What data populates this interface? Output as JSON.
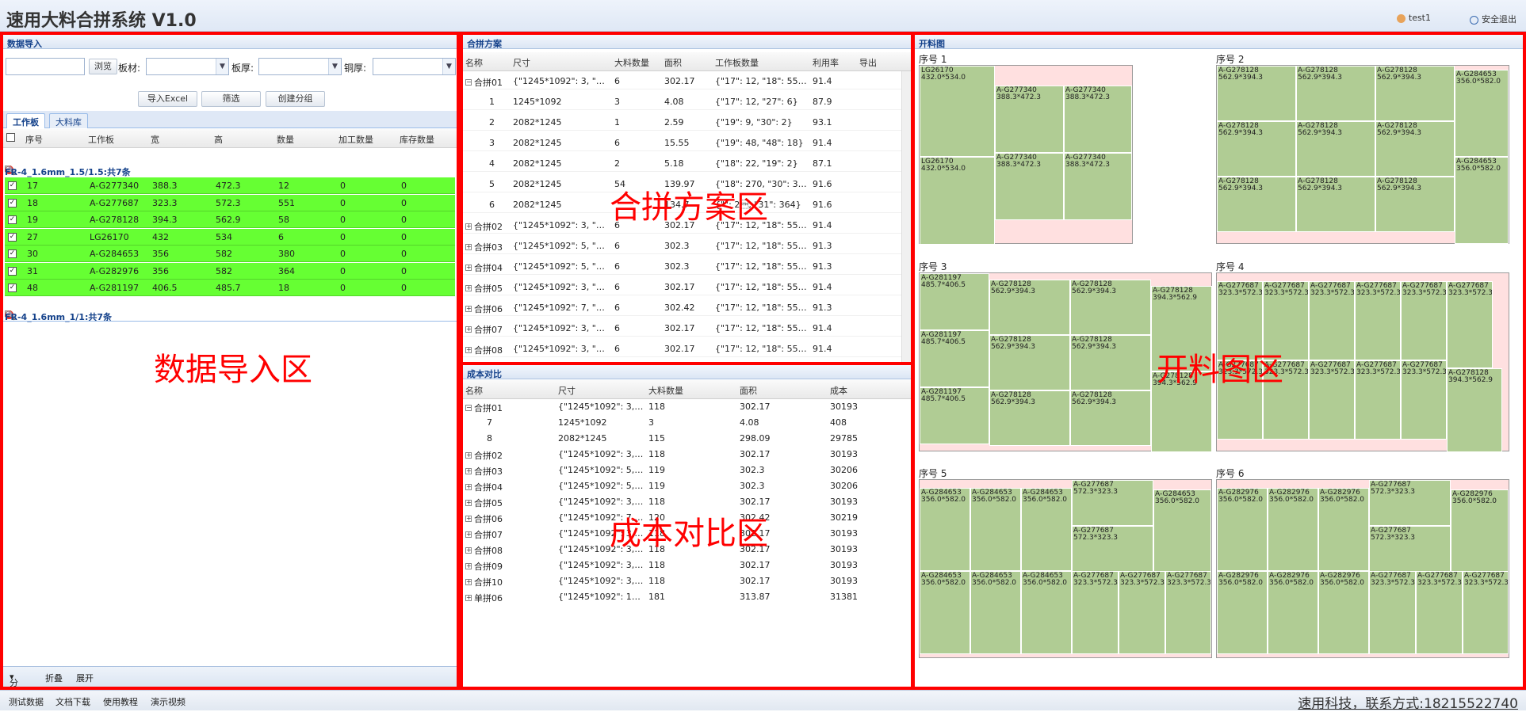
{
  "app": {
    "title": "速用大料合拼系统 V1.0",
    "user": "test1",
    "logout": "安全退出"
  },
  "zones": {
    "import": "数据导入区",
    "plan": "合拼方案区",
    "cost": "成本对比区",
    "cut": "开料图区"
  },
  "import": {
    "header": "数据导入",
    "browse": "浏览",
    "board_label": "板材:",
    "thickness_label": "板厚:",
    "copper_label": "铜厚:",
    "btn_excel": "导入Excel",
    "btn_filter": "筛选",
    "btn_group": "创建分组",
    "tabs": [
      "工作板",
      "大料库"
    ],
    "columns": [
      "序号",
      "工作板",
      "宽",
      "高",
      "数量",
      "加工数量",
      "库存数量"
    ],
    "group1": "FR-4_1.6mm_1.5/1.5:共7条",
    "group2": "FR-4_1.6mm_1/1:共7条",
    "rows": [
      [
        "17",
        "A-G277340",
        "388.3",
        "472.3",
        "12",
        "0",
        "0"
      ],
      [
        "18",
        "A-G277687",
        "323.3",
        "572.3",
        "551",
        "0",
        "0"
      ],
      [
        "19",
        "A-G278128",
        "394.3",
        "562.9",
        "58",
        "0",
        "0"
      ],
      [
        "27",
        "LG26170",
        "432",
        "534",
        "6",
        "0",
        "0"
      ],
      [
        "30",
        "A-G284653",
        "356",
        "582",
        "380",
        "0",
        "0"
      ],
      [
        "31",
        "A-G282976",
        "356",
        "582",
        "364",
        "0",
        "0"
      ],
      [
        "48",
        "A-G281197",
        "406.5",
        "485.7",
        "18",
        "0",
        "0"
      ]
    ],
    "toolbar": {
      "group": "分组",
      "collapse": "折叠",
      "expand": "展开"
    }
  },
  "plan": {
    "header": "合拼方案",
    "columns": [
      "名称",
      "尺寸",
      "大料数量",
      "面积",
      "工作板数量",
      "利用率",
      "导出"
    ],
    "rows": [
      [
        "合拼01",
        "{\"1245*1092\": 3, \"20...",
        "6",
        "302.17",
        "{\"17\": 12, \"18\": 552, ...",
        "91.4",
        "g"
      ],
      [
        "1",
        "1245*1092",
        "3",
        "4.08",
        "{\"17\": 12, \"27\": 6}",
        "87.9",
        "c"
      ],
      [
        "2",
        "2082*1245",
        "1",
        "2.59",
        "{\"19\": 9, \"30\": 2}",
        "93.1",
        "c"
      ],
      [
        "3",
        "2082*1245",
        "6",
        "15.55",
        "{\"19\": 48, \"48\": 18}",
        "91.4",
        "c"
      ],
      [
        "4",
        "2082*1245",
        "2",
        "5.18",
        "{\"18\": 22, \"19\": 2}",
        "87.1",
        "c"
      ],
      [
        "5",
        "2082*1245",
        "54",
        "139.97",
        "{\"18\": 270, \"30\": 378}",
        "91.6",
        "c"
      ],
      [
        "6",
        "2082*1245",
        "",
        "134.7",
        "{\"\": 2\u0002, \"31\": 364}",
        "91.6",
        "c"
      ],
      [
        "合拼02",
        "{\"1245*1092\": 3, \"20...",
        "6",
        "302.17",
        "{\"17\": 12, \"18\": 554, ...",
        "91.4",
        "g"
      ],
      [
        "合拼03",
        "{\"1245*1092\": 5, \"20...",
        "6",
        "302.3",
        "{\"17\": 12, \"18\": 552, ...",
        "91.3",
        "g"
      ],
      [
        "合拼04",
        "{\"1245*1092\": 5, \"20...",
        "6",
        "302.3",
        "{\"17\": 12, \"18\": 552, ...",
        "91.3",
        "g"
      ],
      [
        "合拼05",
        "{\"1245*1092\": 3, \"20...",
        "6",
        "302.17",
        "{\"17\": 12, \"18\": 551, ...",
        "91.4",
        "g"
      ],
      [
        "合拼06",
        "{\"1245*1092\": 7, \"20...",
        "6",
        "302.42",
        "{\"17\": 12, \"18\": 551, ...",
        "91.3",
        "g"
      ],
      [
        "合拼07",
        "{\"1245*1092\": 3, \"20...",
        "6",
        "302.17",
        "{\"17\": 12, \"18\": 551, ...",
        "91.4",
        "g"
      ],
      [
        "合拼08",
        "{\"1245*1092\": 3, \"20...",
        "6",
        "302.17",
        "{\"17\": 12, \"18\": 552, ...",
        "91.4",
        "g"
      ]
    ]
  },
  "cost": {
    "header": "成本对比",
    "columns": [
      "名称",
      "尺寸",
      "大料数量",
      "面积",
      "成本"
    ],
    "rows": [
      [
        "合拼01",
        "{\"1245*1092\": 3, \"...",
        "118",
        "302.17",
        "30193",
        "g"
      ],
      [
        "7",
        "1245*1092",
        "3",
        "4.08",
        "408",
        "c"
      ],
      [
        "8",
        "2082*1245",
        "115",
        "298.09",
        "29785",
        "c"
      ],
      [
        "合拼02",
        "{\"1245*1092\": 3, \"...",
        "118",
        "302.17",
        "30193",
        "g"
      ],
      [
        "合拼03",
        "{\"1245*1092\": 5, \"...",
        "119",
        "302.3",
        "30206",
        "g"
      ],
      [
        "合拼04",
        "{\"1245*1092\": 5, \"...",
        "119",
        "302.3",
        "30206",
        "g"
      ],
      [
        "合拼05",
        "{\"1245*1092\": 3, \"...",
        "118",
        "302.17",
        "30193",
        "g"
      ],
      [
        "合拼06",
        "{\"1245*1092\": 7, \"...",
        "120",
        "302.42",
        "30219",
        "g"
      ],
      [
        "合拼07",
        "{\"1245*1092\": 3, \"...",
        "118",
        "302.17",
        "30193",
        "g"
      ],
      [
        "合拼08",
        "{\"1245*1092\": 3, \"...",
        "118",
        "302.17",
        "30193",
        "g"
      ],
      [
        "合拼09",
        "{\"1245*1092\": 3, \"...",
        "118",
        "302.17",
        "30193",
        "g"
      ],
      [
        "合拼10",
        "{\"1245*1092\": 3, \"...",
        "118",
        "302.17",
        "30193",
        "g"
      ],
      [
        "单拼06",
        "{\"1245*1092\": 126...",
        "181",
        "313.87",
        "31381",
        "g"
      ]
    ]
  },
  "cut": {
    "header": "开料图",
    "sheets": [
      {
        "label": "序号 1",
        "pieces": [
          [
            "LG26170",
            "432.0*534.0"
          ],
          [
            "A-G277340",
            "388.3*472.3"
          ],
          [
            "A-G277340",
            "388.3*472.3"
          ],
          [
            "LG26170",
            "432.0*534.0"
          ],
          [
            "A-G277340",
            "388.3*472.3"
          ],
          [
            "A-G277340",
            "388.3*472.3"
          ]
        ]
      },
      {
        "label": "序号 2",
        "pieces": [
          [
            "A-G278128",
            "562.9*394.3"
          ],
          [
            "A-G278128",
            "562.9*394.3"
          ],
          [
            "A-G278128",
            "562.9*394.3"
          ],
          [
            "A-G284653",
            "356.0*582.0"
          ],
          [
            "A-G278128",
            "562.9*394.3"
          ],
          [
            "A-G278128",
            "562.9*394.3"
          ],
          [
            "A-G278128",
            "562.9*394.3"
          ],
          [
            "A-G284653",
            "356.0*582.0"
          ],
          [
            "A-G278128",
            "562.9*394.3"
          ],
          [
            "A-G278128",
            "562.9*394.3"
          ],
          [
            "A-G278128",
            "562.9*394.3"
          ]
        ]
      },
      {
        "label": "序号 3",
        "pieces": [
          [
            "A-G281197",
            "485.7*406.5"
          ],
          [
            "A-G278128",
            "562.9*394.3"
          ],
          [
            "A-G278128",
            "562.9*394.3"
          ],
          [
            "A-G278128",
            "394.3*562.9"
          ],
          [
            "A-G281197",
            "485.7*406.5"
          ],
          [
            "A-G278128",
            "562.9*394.3"
          ],
          [
            "A-G278128",
            "562.9*394.3"
          ],
          [
            "A-G278128",
            "394.3*562.9"
          ],
          [
            "A-G281197",
            "485.7*406.5"
          ],
          [
            "A-G278128",
            "562.9*394.3"
          ],
          [
            "A-G278128",
            "562.9*394.3"
          ]
        ]
      },
      {
        "label": "序号 4",
        "pieces": [
          [
            "A-G277687",
            "323.3*572.3"
          ],
          [
            "A-G277687",
            "323.3*572.3"
          ],
          [
            "A-G277687",
            "323.3*572.3"
          ],
          [
            "A-G277687",
            "323.3*572.3"
          ],
          [
            "A-G277687",
            "323.3*572.3"
          ],
          [
            "A-G277687",
            "323.3*572.3"
          ],
          [
            "A-G277687",
            "323.3*572.3"
          ],
          [
            "A-G277687",
            "323.3*572.3"
          ],
          [
            "A-G277687",
            "323.3*572.3"
          ],
          [
            "A-G277687",
            "323.3*572.3"
          ],
          [
            "A-G277687",
            "323.3*572.3"
          ],
          [
            "A-G278128",
            "394.3*562.9"
          ]
        ]
      },
      {
        "label": "序号 5",
        "pieces": [
          [
            "A-G284653",
            "356.0*582.0"
          ],
          [
            "A-G284653",
            "356.0*582.0"
          ],
          [
            "A-G284653",
            "356.0*582.0"
          ],
          [
            "A-G277687",
            "572.3*323.3"
          ],
          [
            "A-G284653",
            "356.0*582.0"
          ],
          [
            "A-G277687",
            "572.3*323.3"
          ],
          [
            "A-G284653",
            "356.0*582.0"
          ],
          [
            "A-G284653",
            "356.0*582.0"
          ],
          [
            "A-G284653",
            "356.0*582.0"
          ],
          [
            "A-G277687",
            "323.3*572.3"
          ],
          [
            "A-G277687",
            "323.3*572.3"
          ],
          [
            "A-G277687",
            "323.3*572.3"
          ]
        ]
      },
      {
        "label": "序号 6",
        "pieces": [
          [
            "A-G282976",
            "356.0*582.0"
          ],
          [
            "A-G282976",
            "356.0*582.0"
          ],
          [
            "A-G282976",
            "356.0*582.0"
          ],
          [
            "A-G277687",
            "572.3*323.3"
          ],
          [
            "A-G282976",
            "356.0*582.0"
          ],
          [
            "A-G277687",
            "572.3*323.3"
          ],
          [
            "A-G282976",
            "356.0*582.0"
          ],
          [
            "A-G282976",
            "356.0*582.0"
          ],
          [
            "A-G282976",
            "356.0*582.0"
          ],
          [
            "A-G277687",
            "323.3*572.3"
          ],
          [
            "A-G277687",
            "323.3*572.3"
          ],
          [
            "A-G277687",
            "323.3*572.3"
          ]
        ]
      }
    ]
  },
  "footer": {
    "links": [
      "测试数据",
      "文档下载",
      "使用教程",
      "演示视频"
    ],
    "contact": "速用科技，联系方式:18215522740"
  },
  "colors": {
    "accent": "#15428b",
    "highlight": "#66ff33",
    "piece": "#b0cc94",
    "sheet": "#ffe0e0",
    "zone": "#ff0000"
  }
}
